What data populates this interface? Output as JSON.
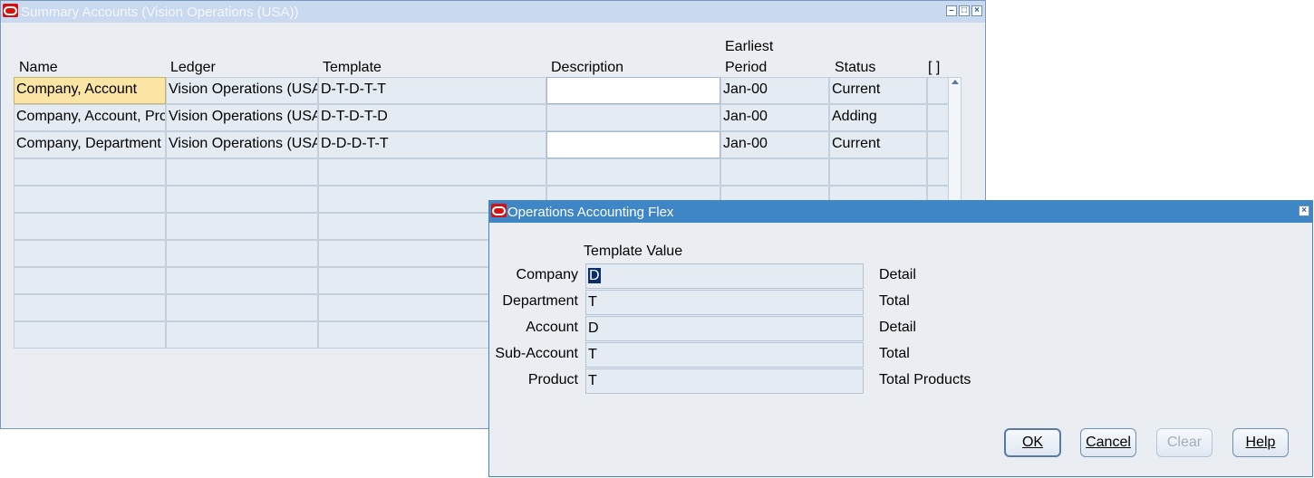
{
  "main_window": {
    "title": "Summary Accounts (Vision Operations (USA))",
    "columns": {
      "name": "Name",
      "ledger": "Ledger",
      "template": "Template",
      "description": "Description",
      "earliest_period_line1": "Earliest",
      "earliest_period_line2": "Period",
      "status": "Status",
      "flex": "[ ]"
    },
    "rows": [
      {
        "name": "Company, Account",
        "ledger": "Vision Operations (USA)",
        "template": "D-T-D-T-T",
        "description": "",
        "period": "Jan-00",
        "status": "Current"
      },
      {
        "name": "Company, Account, Product",
        "ledger": "Vision Operations (USA)",
        "template": "D-T-D-T-D",
        "description": "",
        "period": "Jan-00",
        "status": "Adding"
      },
      {
        "name": "Company, Department",
        "ledger": "Vision Operations (USA)",
        "template": "D-D-D-T-T",
        "description": "",
        "period": "Jan-00",
        "status": "Current"
      }
    ]
  },
  "dialog": {
    "title": "Operations Accounting Flex",
    "column_header": "Template Value",
    "segments": [
      {
        "label": "Company",
        "value": "D",
        "meaning": "Detail"
      },
      {
        "label": "Department",
        "value": "T",
        "meaning": "Total"
      },
      {
        "label": "Account",
        "value": "D",
        "meaning": "Detail"
      },
      {
        "label": "Sub-Account",
        "value": "T",
        "meaning": "Total"
      },
      {
        "label": "Product",
        "value": "T",
        "meaning": "Total Products"
      }
    ],
    "buttons": {
      "ok": "OK",
      "cancel": "Cancel",
      "clear": "Clear",
      "help": "Help"
    }
  },
  "icons": {
    "app": "oracle-icon",
    "minimize": "minimize-icon",
    "maximize": "maximize-icon",
    "close": "close-icon"
  }
}
